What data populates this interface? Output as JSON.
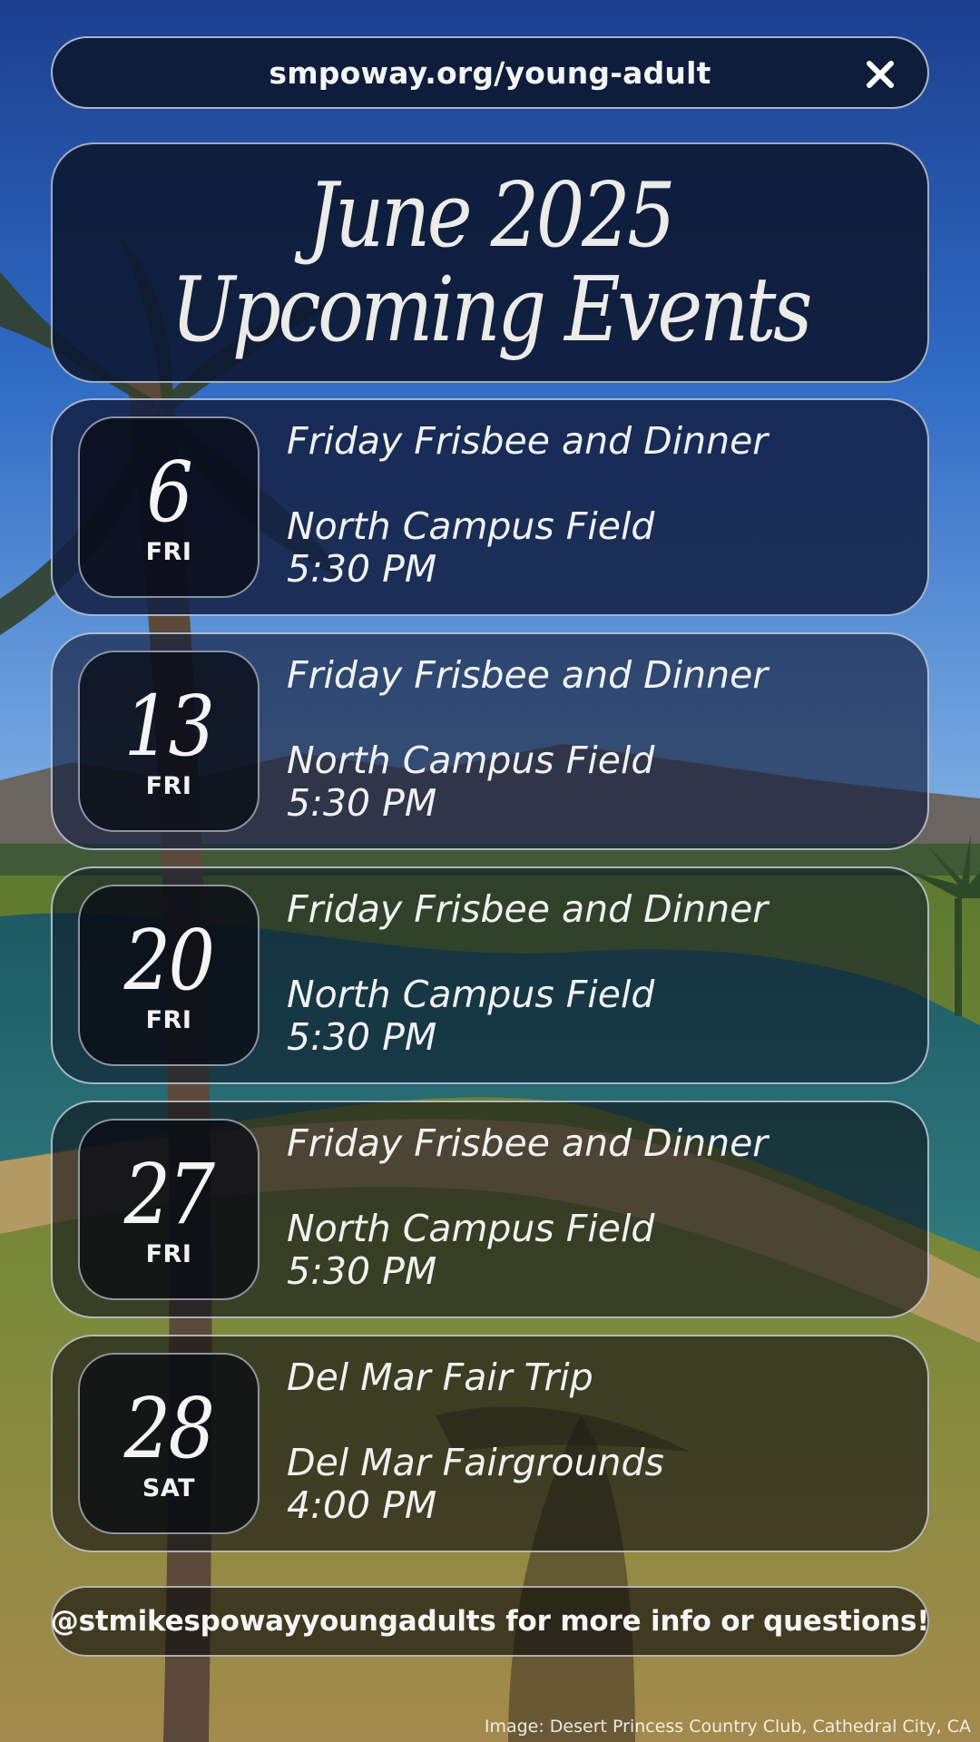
{
  "header": {
    "url": "smpoway.org/young-adult",
    "close_icon": "close-icon"
  },
  "title": {
    "line1": "June 2025",
    "line2": "Upcoming Events"
  },
  "events": [
    {
      "day": "6",
      "weekday": "FRI",
      "title": "Friday Frisbee and Dinner",
      "location": "North Campus Field",
      "time": "5:30 PM"
    },
    {
      "day": "13",
      "weekday": "FRI",
      "title": "Friday Frisbee and Dinner",
      "location": "North Campus Field",
      "time": "5:30 PM"
    },
    {
      "day": "20",
      "weekday": "FRI",
      "title": "Friday Frisbee and Dinner",
      "location": "North Campus Field",
      "time": "5:30 PM"
    },
    {
      "day": "27",
      "weekday": "FRI",
      "title": "Friday Frisbee and Dinner",
      "location": "North Campus Field",
      "time": "5:30 PM"
    },
    {
      "day": "28",
      "weekday": "SAT",
      "title": "Del Mar Fair Trip",
      "location": "Del Mar Fairgrounds",
      "time": "4:00 PM"
    }
  ],
  "footer": {
    "contact": "@stmikespowayyoungadults for more info or questions!",
    "credit": "Image: Desert Princess Country Club, Cathedral City, CA"
  }
}
